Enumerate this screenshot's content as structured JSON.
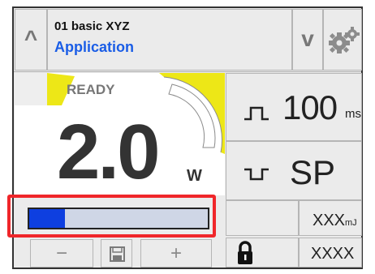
{
  "header": {
    "up_glyph": "^",
    "program": "01 basic XYZ",
    "mode_name": "Application",
    "down_glyph": "v",
    "settings_icon": "gears-icon"
  },
  "main": {
    "status": "READY",
    "value": "2.0",
    "unit": "W",
    "progress": 0.2
  },
  "footer": {
    "minus_glyph": "−",
    "save_icon": "floppy-disk-icon",
    "plus_glyph": "+"
  },
  "side": {
    "pulse_icon": "square-pulse-icon",
    "time_value": "100",
    "time_unit": "ms",
    "mode_icon": "inverted-pulse-icon",
    "mode_label": "SP",
    "energy_value": "XXX",
    "energy_unit": "mJ",
    "lock_icon": "padlock-icon",
    "counter": "XXXX"
  },
  "colors": {
    "accent_blue": "#1a5de6",
    "ready_yellow": "#ede717",
    "progress_fill": "#0e3fe0",
    "progress_track": "#cfd6e6",
    "highlight_red": "#f0262a"
  }
}
